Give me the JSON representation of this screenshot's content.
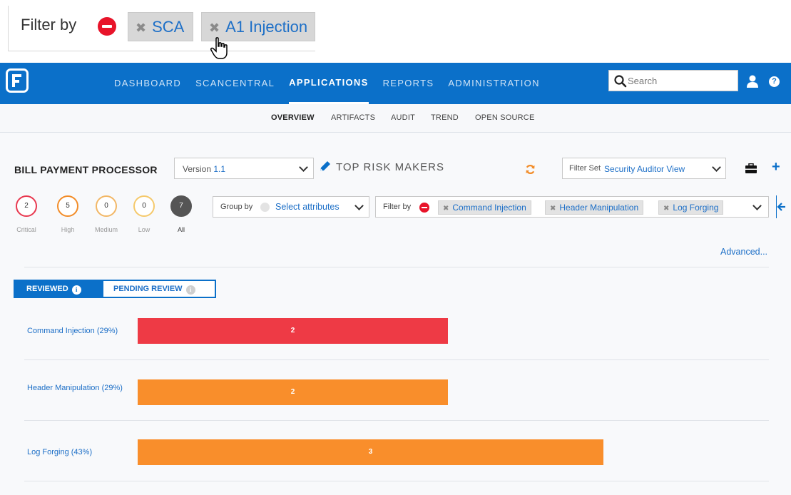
{
  "callout": {
    "label": "Filter by",
    "chips": [
      {
        "x": "✖",
        "label": "SCA"
      },
      {
        "x": "✖",
        "label": "A1 Injection"
      }
    ]
  },
  "topnav": {
    "items": [
      "DASHBOARD",
      "SCANCENTRAL",
      "APPLICATIONS",
      "REPORTS",
      "ADMINISTRATION"
    ],
    "active": "APPLICATIONS",
    "search_placeholder": "Search"
  },
  "subnav": {
    "items": [
      "OVERVIEW",
      "ARTIFACTS",
      "AUDIT",
      "TREND",
      "OPEN SOURCE"
    ],
    "active": "OVERVIEW"
  },
  "header": {
    "app_title": "BILL PAYMENT PROCESSOR",
    "version_label": "Version",
    "version_value": "1.1",
    "top_risk_makers": "TOP RISK MAKERS",
    "filter_set_label": "Filter Set",
    "filter_set_value": "Security Auditor View"
  },
  "severity": [
    {
      "count": "2",
      "label": "Critical",
      "color": "#e8384f"
    },
    {
      "count": "5",
      "label": "High",
      "color": "#f28c28"
    },
    {
      "count": "0",
      "label": "Medium",
      "color": "#f2b766"
    },
    {
      "count": "0",
      "label": "Low",
      "color": "#f5c96b"
    },
    {
      "count": "7",
      "label": "All",
      "color": "#555555"
    }
  ],
  "groupby": {
    "label": "Group by",
    "value": "Select attributes"
  },
  "filterby": {
    "label": "Filter by",
    "chips": [
      {
        "x": "✖",
        "label": "Command Injection"
      },
      {
        "x": "✖",
        "label": "Header Manipulation"
      },
      {
        "x": "✖",
        "label": "Log Forging"
      }
    ]
  },
  "advanced": "Advanced...",
  "tabs": {
    "reviewed": "REVIEWED",
    "pending": "PENDING REVIEW",
    "info": "i"
  },
  "bars": [
    {
      "label": "Command Injection (29%)",
      "count": 2,
      "color": "#ee3a45"
    },
    {
      "label": "Header Manipulation (29%)",
      "count": 2,
      "color": "#f98e2b"
    },
    {
      "label": "Log Forging (43%)",
      "count": 3,
      "color": "#f98e2b"
    }
  ],
  "colors": {
    "brand": "#0b70c9",
    "link": "#1d6fc7",
    "remove": "#e8142a"
  }
}
